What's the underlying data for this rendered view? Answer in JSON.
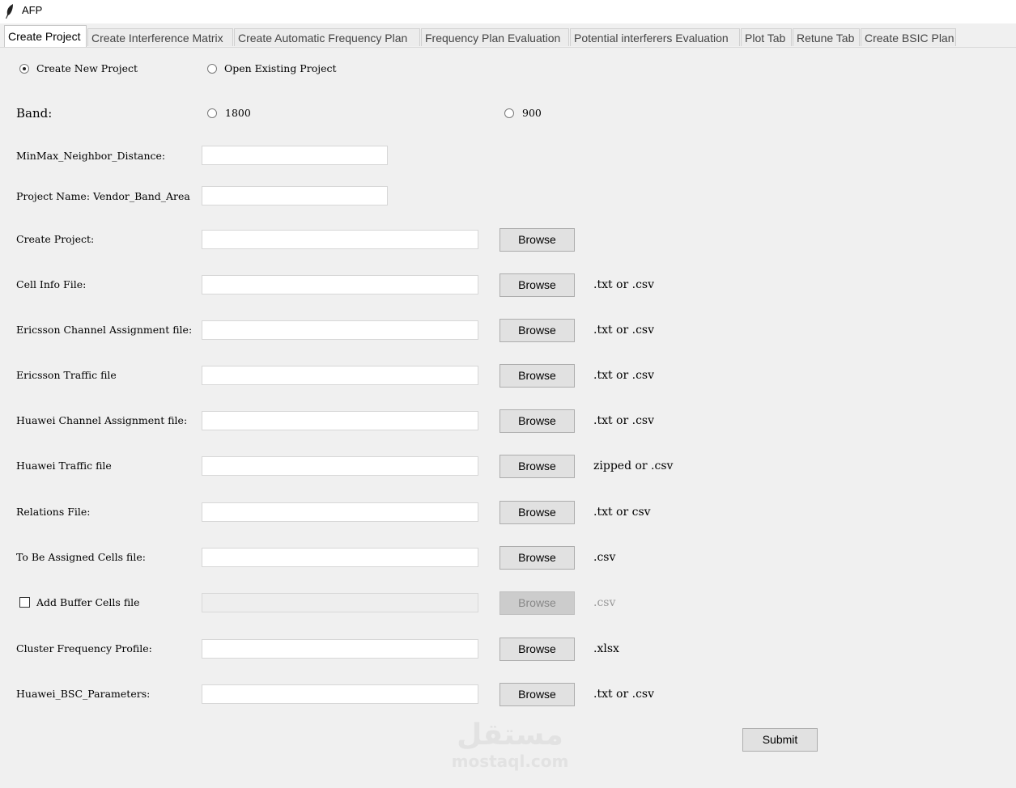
{
  "window": {
    "title": "AFP",
    "icon": "feather-icon"
  },
  "tabs": [
    "Create Project",
    "Create Interference Matrix",
    "Create Automatic Frequency Plan",
    "Frequency Plan Evaluation",
    "Potential interferers Evaluation",
    "Plot Tab",
    "Retune Tab",
    "Create BSIC Plan"
  ],
  "project_mode": {
    "create_new": "Create New Project",
    "open_existing": "Open Existing Project",
    "selected": "Create New Project"
  },
  "band": {
    "label": "Band:",
    "option_1800": "1800",
    "option_900": "900",
    "selected": ""
  },
  "fields": {
    "minmax_neighbor_distance": {
      "label": "MinMax_Neighbor_Distance:",
      "value": ""
    },
    "project_name": {
      "label": "Project Name: Vendor_Band_Area",
      "value": ""
    },
    "create_project": {
      "label": "Create Project:",
      "value": ""
    },
    "cell_info_file": {
      "label": "Cell Info File:",
      "value": "",
      "hint": ".txt or .csv"
    },
    "ericsson_channel_assignment": {
      "label": "Ericsson Channel Assignment file:",
      "value": "",
      "hint": ".txt or .csv"
    },
    "ericsson_traffic": {
      "label": "Ericsson Traffic file",
      "value": "",
      "hint": ".txt or .csv"
    },
    "huawei_channel_assignment": {
      "label": "Huawei Channel Assignment file:",
      "value": "",
      "hint": ".txt or .csv"
    },
    "huawei_traffic": {
      "label": "Huawei Traffic file",
      "value": "",
      "hint": "zipped or .csv"
    },
    "relations_file": {
      "label": "Relations File:",
      "value": "",
      "hint": ".txt or csv"
    },
    "to_be_assigned_cells": {
      "label": "To Be Assigned Cells file:",
      "value": "",
      "hint": ".csv"
    },
    "buffer_cells": {
      "label": "Add Buffer Cells file",
      "value": "",
      "hint": ".csv",
      "checked": false
    },
    "cluster_frequency_profile": {
      "label": "Cluster Frequency Profile:",
      "value": "",
      "hint": ".xlsx"
    },
    "huawei_bsc_parameters": {
      "label": "Huawei_BSC_Parameters:",
      "value": "",
      "hint": ".txt or .csv"
    }
  },
  "buttons": {
    "browse": "Browse",
    "submit": "Submit"
  },
  "watermark": {
    "arabic": "مستقل",
    "latin": "mostaql.com"
  }
}
